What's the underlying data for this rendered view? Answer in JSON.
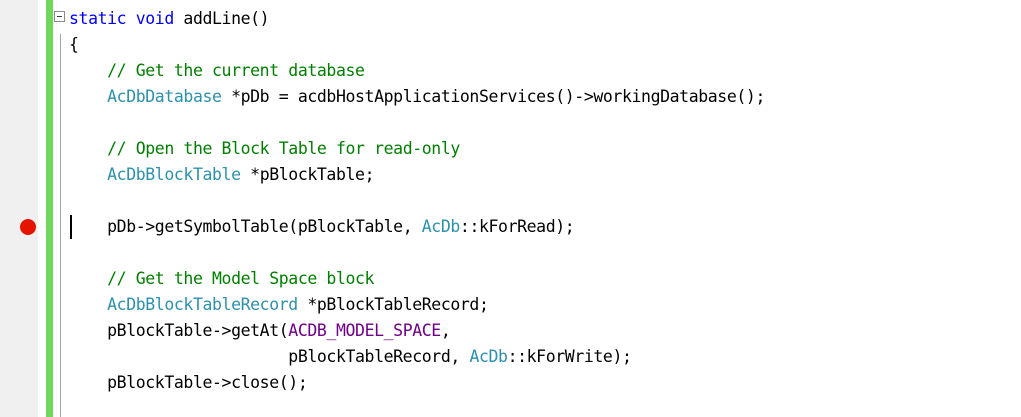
{
  "editor": {
    "colors": {
      "keyword": "#0000ff",
      "type": "#2b91af",
      "comment": "#008000",
      "macro": "#6f008a",
      "text": "#000000",
      "change_bar": "#6fd85a",
      "breakpoint": "#e51400"
    },
    "lines": {
      "l1": {
        "kw": "static void",
        "text": " addLine()"
      },
      "l2": {
        "text": "{"
      },
      "l3": {
        "indent": "    ",
        "comment": "// Get the current database"
      },
      "l4": {
        "indent": "    ",
        "type": "AcDbDatabase",
        "text": " *pDb = acdbHostApplicationServices()->workingDatabase();"
      },
      "l6": {
        "indent": "    ",
        "comment": "// Open the Block Table for read-only"
      },
      "l7": {
        "indent": "    ",
        "type": "AcDbBlockTable",
        "text": " *pBlockTable;"
      },
      "l8": {
        "indent": "    ",
        "text": "pDb->getSymbolTable(pBlockTable, ",
        "type": "AcDb",
        "text2": "::kForRead);"
      },
      "l10": {
        "indent": "    ",
        "comment": "// Get the Model Space block"
      },
      "l11": {
        "indent": "    ",
        "type": "AcDbBlockTableRecord",
        "text": " *pBlockTableRecord;"
      },
      "l12": {
        "indent": "    ",
        "text": "pBlockTable->getAt(",
        "macro": "ACDB_MODEL_SPACE",
        "text2": ","
      },
      "l13": {
        "indent": "                       ",
        "text": "pBlockTableRecord, ",
        "type": "AcDb",
        "text2": "::kForWrite);"
      },
      "l14": {
        "indent": "    ",
        "text": "pBlockTable->close();"
      }
    }
  }
}
